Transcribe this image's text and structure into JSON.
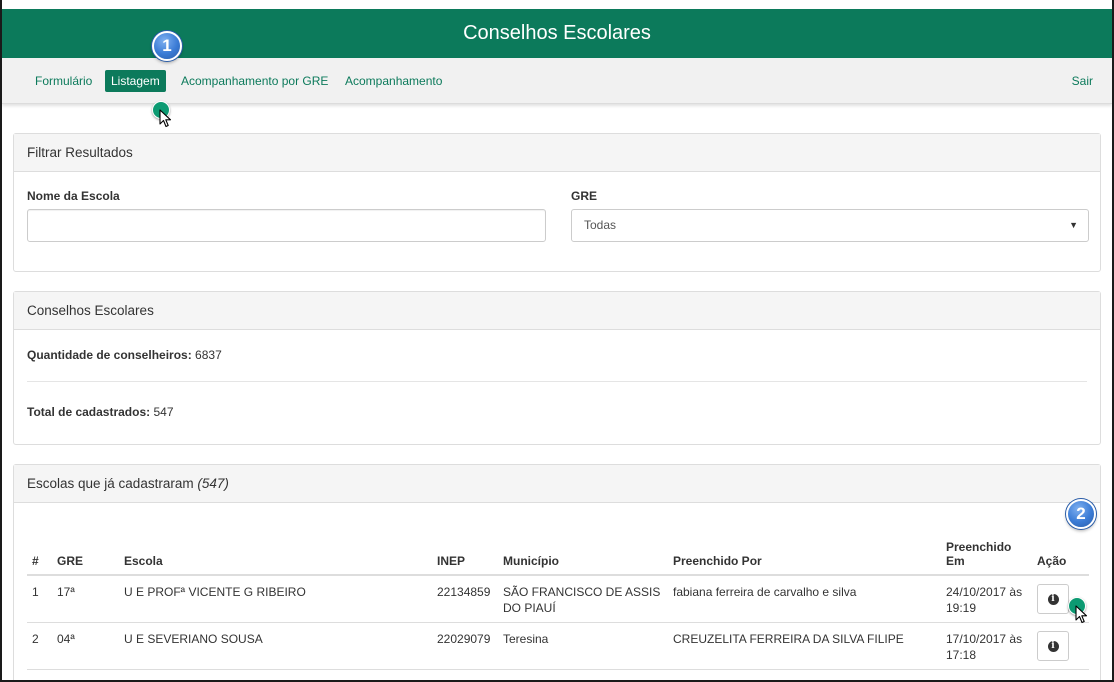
{
  "header": {
    "title": "Conselhos Escolares"
  },
  "nav": {
    "items": [
      {
        "label": "Formulário"
      },
      {
        "label": "Listagem"
      },
      {
        "label": "Acompanhamento por GRE"
      },
      {
        "label": "Acompanhamento"
      }
    ],
    "logout": "Sair"
  },
  "annotations": {
    "badge1": "1",
    "badge2": "2"
  },
  "filter": {
    "heading": "Filtrar Resultados",
    "school_label": "Nome da Escola",
    "school_value": "",
    "gre_label": "GRE",
    "gre_selected": "Todas"
  },
  "summary": {
    "heading": "Conselhos Escolares",
    "quantity_label": "Quantidade de conselheiros:",
    "quantity_value": "6837",
    "total_label": "Total de cadastrados:",
    "total_value": "547"
  },
  "list": {
    "heading": "Escolas que já cadastraram",
    "heading_count": "(547)",
    "columns": {
      "num": "#",
      "gre": "GRE",
      "school": "Escola",
      "inep": "INEP",
      "city": "Município",
      "filled_by": "Preenchido Por",
      "filled_at": "Preenchido Em",
      "action": "Ação"
    },
    "rows": [
      {
        "num": "1",
        "gre": "17ª",
        "school": "U E PROFª VICENTE G RIBEIRO",
        "inep": "22134859",
        "city": "SÃO FRANCISCO DE ASSIS DO PIAUÍ",
        "filled_by": "fabiana ferreira de carvalho e silva",
        "filled_at": "24/10/2017 às 19:19"
      },
      {
        "num": "2",
        "gre": "04ª",
        "school": "U E SEVERIANO SOUSA",
        "inep": "22029079",
        "city": "Teresina",
        "filled_by": "CREUZELITA FERREIRA DA SILVA FILIPE",
        "filled_at": "17/10/2017 às 17:18"
      }
    ]
  },
  "colors": {
    "brand": "#0c7a5b",
    "badge": "#3a7bd5"
  }
}
